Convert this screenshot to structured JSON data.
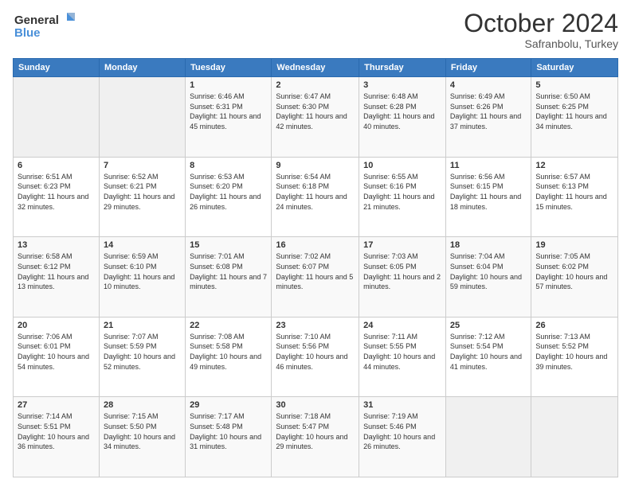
{
  "header": {
    "logo_line1": "General",
    "logo_line2": "Blue",
    "month": "October 2024",
    "location": "Safranbolu, Turkey"
  },
  "days_of_week": [
    "Sunday",
    "Monday",
    "Tuesday",
    "Wednesday",
    "Thursday",
    "Friday",
    "Saturday"
  ],
  "weeks": [
    [
      {
        "num": "",
        "sunrise": "",
        "sunset": "",
        "daylight": ""
      },
      {
        "num": "",
        "sunrise": "",
        "sunset": "",
        "daylight": ""
      },
      {
        "num": "1",
        "sunrise": "Sunrise: 6:46 AM",
        "sunset": "Sunset: 6:31 PM",
        "daylight": "Daylight: 11 hours and 45 minutes."
      },
      {
        "num": "2",
        "sunrise": "Sunrise: 6:47 AM",
        "sunset": "Sunset: 6:30 PM",
        "daylight": "Daylight: 11 hours and 42 minutes."
      },
      {
        "num": "3",
        "sunrise": "Sunrise: 6:48 AM",
        "sunset": "Sunset: 6:28 PM",
        "daylight": "Daylight: 11 hours and 40 minutes."
      },
      {
        "num": "4",
        "sunrise": "Sunrise: 6:49 AM",
        "sunset": "Sunset: 6:26 PM",
        "daylight": "Daylight: 11 hours and 37 minutes."
      },
      {
        "num": "5",
        "sunrise": "Sunrise: 6:50 AM",
        "sunset": "Sunset: 6:25 PM",
        "daylight": "Daylight: 11 hours and 34 minutes."
      }
    ],
    [
      {
        "num": "6",
        "sunrise": "Sunrise: 6:51 AM",
        "sunset": "Sunset: 6:23 PM",
        "daylight": "Daylight: 11 hours and 32 minutes."
      },
      {
        "num": "7",
        "sunrise": "Sunrise: 6:52 AM",
        "sunset": "Sunset: 6:21 PM",
        "daylight": "Daylight: 11 hours and 29 minutes."
      },
      {
        "num": "8",
        "sunrise": "Sunrise: 6:53 AM",
        "sunset": "Sunset: 6:20 PM",
        "daylight": "Daylight: 11 hours and 26 minutes."
      },
      {
        "num": "9",
        "sunrise": "Sunrise: 6:54 AM",
        "sunset": "Sunset: 6:18 PM",
        "daylight": "Daylight: 11 hours and 24 minutes."
      },
      {
        "num": "10",
        "sunrise": "Sunrise: 6:55 AM",
        "sunset": "Sunset: 6:16 PM",
        "daylight": "Daylight: 11 hours and 21 minutes."
      },
      {
        "num": "11",
        "sunrise": "Sunrise: 6:56 AM",
        "sunset": "Sunset: 6:15 PM",
        "daylight": "Daylight: 11 hours and 18 minutes."
      },
      {
        "num": "12",
        "sunrise": "Sunrise: 6:57 AM",
        "sunset": "Sunset: 6:13 PM",
        "daylight": "Daylight: 11 hours and 15 minutes."
      }
    ],
    [
      {
        "num": "13",
        "sunrise": "Sunrise: 6:58 AM",
        "sunset": "Sunset: 6:12 PM",
        "daylight": "Daylight: 11 hours and 13 minutes."
      },
      {
        "num": "14",
        "sunrise": "Sunrise: 6:59 AM",
        "sunset": "Sunset: 6:10 PM",
        "daylight": "Daylight: 11 hours and 10 minutes."
      },
      {
        "num": "15",
        "sunrise": "Sunrise: 7:01 AM",
        "sunset": "Sunset: 6:08 PM",
        "daylight": "Daylight: 11 hours and 7 minutes."
      },
      {
        "num": "16",
        "sunrise": "Sunrise: 7:02 AM",
        "sunset": "Sunset: 6:07 PM",
        "daylight": "Daylight: 11 hours and 5 minutes."
      },
      {
        "num": "17",
        "sunrise": "Sunrise: 7:03 AM",
        "sunset": "Sunset: 6:05 PM",
        "daylight": "Daylight: 11 hours and 2 minutes."
      },
      {
        "num": "18",
        "sunrise": "Sunrise: 7:04 AM",
        "sunset": "Sunset: 6:04 PM",
        "daylight": "Daylight: 10 hours and 59 minutes."
      },
      {
        "num": "19",
        "sunrise": "Sunrise: 7:05 AM",
        "sunset": "Sunset: 6:02 PM",
        "daylight": "Daylight: 10 hours and 57 minutes."
      }
    ],
    [
      {
        "num": "20",
        "sunrise": "Sunrise: 7:06 AM",
        "sunset": "Sunset: 6:01 PM",
        "daylight": "Daylight: 10 hours and 54 minutes."
      },
      {
        "num": "21",
        "sunrise": "Sunrise: 7:07 AM",
        "sunset": "Sunset: 5:59 PM",
        "daylight": "Daylight: 10 hours and 52 minutes."
      },
      {
        "num": "22",
        "sunrise": "Sunrise: 7:08 AM",
        "sunset": "Sunset: 5:58 PM",
        "daylight": "Daylight: 10 hours and 49 minutes."
      },
      {
        "num": "23",
        "sunrise": "Sunrise: 7:10 AM",
        "sunset": "Sunset: 5:56 PM",
        "daylight": "Daylight: 10 hours and 46 minutes."
      },
      {
        "num": "24",
        "sunrise": "Sunrise: 7:11 AM",
        "sunset": "Sunset: 5:55 PM",
        "daylight": "Daylight: 10 hours and 44 minutes."
      },
      {
        "num": "25",
        "sunrise": "Sunrise: 7:12 AM",
        "sunset": "Sunset: 5:54 PM",
        "daylight": "Daylight: 10 hours and 41 minutes."
      },
      {
        "num": "26",
        "sunrise": "Sunrise: 7:13 AM",
        "sunset": "Sunset: 5:52 PM",
        "daylight": "Daylight: 10 hours and 39 minutes."
      }
    ],
    [
      {
        "num": "27",
        "sunrise": "Sunrise: 7:14 AM",
        "sunset": "Sunset: 5:51 PM",
        "daylight": "Daylight: 10 hours and 36 minutes."
      },
      {
        "num": "28",
        "sunrise": "Sunrise: 7:15 AM",
        "sunset": "Sunset: 5:50 PM",
        "daylight": "Daylight: 10 hours and 34 minutes."
      },
      {
        "num": "29",
        "sunrise": "Sunrise: 7:17 AM",
        "sunset": "Sunset: 5:48 PM",
        "daylight": "Daylight: 10 hours and 31 minutes."
      },
      {
        "num": "30",
        "sunrise": "Sunrise: 7:18 AM",
        "sunset": "Sunset: 5:47 PM",
        "daylight": "Daylight: 10 hours and 29 minutes."
      },
      {
        "num": "31",
        "sunrise": "Sunrise: 7:19 AM",
        "sunset": "Sunset: 5:46 PM",
        "daylight": "Daylight: 10 hours and 26 minutes."
      },
      {
        "num": "",
        "sunrise": "",
        "sunset": "",
        "daylight": ""
      },
      {
        "num": "",
        "sunrise": "",
        "sunset": "",
        "daylight": ""
      }
    ]
  ]
}
